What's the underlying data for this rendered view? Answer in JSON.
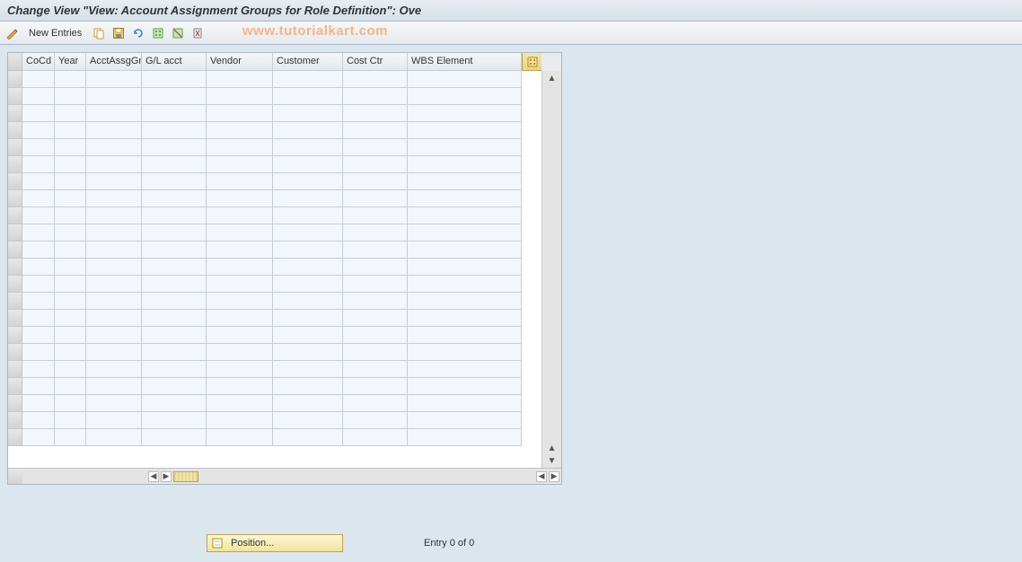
{
  "title": "Change View \"View: Account Assignment Groups for Role Definition\": Ove",
  "watermark": "www.tutorialkart.com",
  "toolbar": {
    "new_entries_label": "New Entries"
  },
  "columns": [
    {
      "label": "CoCd"
    },
    {
      "label": "Year"
    },
    {
      "label": "AcctAssgGr"
    },
    {
      "label": "G/L acct"
    },
    {
      "label": "Vendor"
    },
    {
      "label": "Customer"
    },
    {
      "label": "Cost Ctr"
    },
    {
      "label": "WBS Element"
    }
  ],
  "rows": [],
  "blank_row_count": 22,
  "footer": {
    "position_label": "Position...",
    "entry_status": "Entry 0 of 0"
  }
}
